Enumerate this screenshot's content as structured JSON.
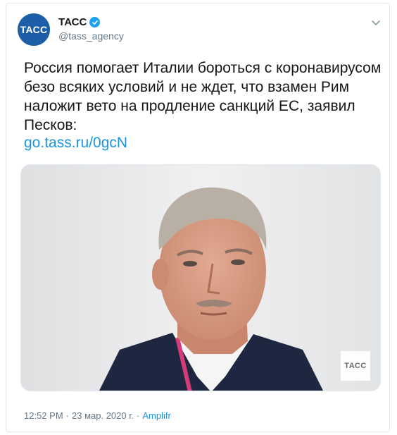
{
  "account": {
    "avatar_text": "ТАСС",
    "display_name": "ТАСС",
    "handle": "@tass_agency"
  },
  "tweet": {
    "text": "Россия помогает Италии бороться с коронавирусом безо всяких условий и не ждет, что взамен Рим наложит вето на продление санкций ЕС, заявил Песков:",
    "link": "go.tass.ru/0gcN"
  },
  "media": {
    "watermark_text": "ТАСС"
  },
  "meta": {
    "time": "12:52 PM",
    "separator": "·",
    "date": "23 мар. 2020 г.",
    "separator2": "·",
    "source": "Amplifr"
  },
  "colors": {
    "link": "#1b95e0",
    "verified": "#1da1f2",
    "avatar": "#1d5ea8",
    "muted": "#657786"
  },
  "icons": {
    "verified": "verified-badge-icon",
    "caret": "chevron-down-icon"
  }
}
